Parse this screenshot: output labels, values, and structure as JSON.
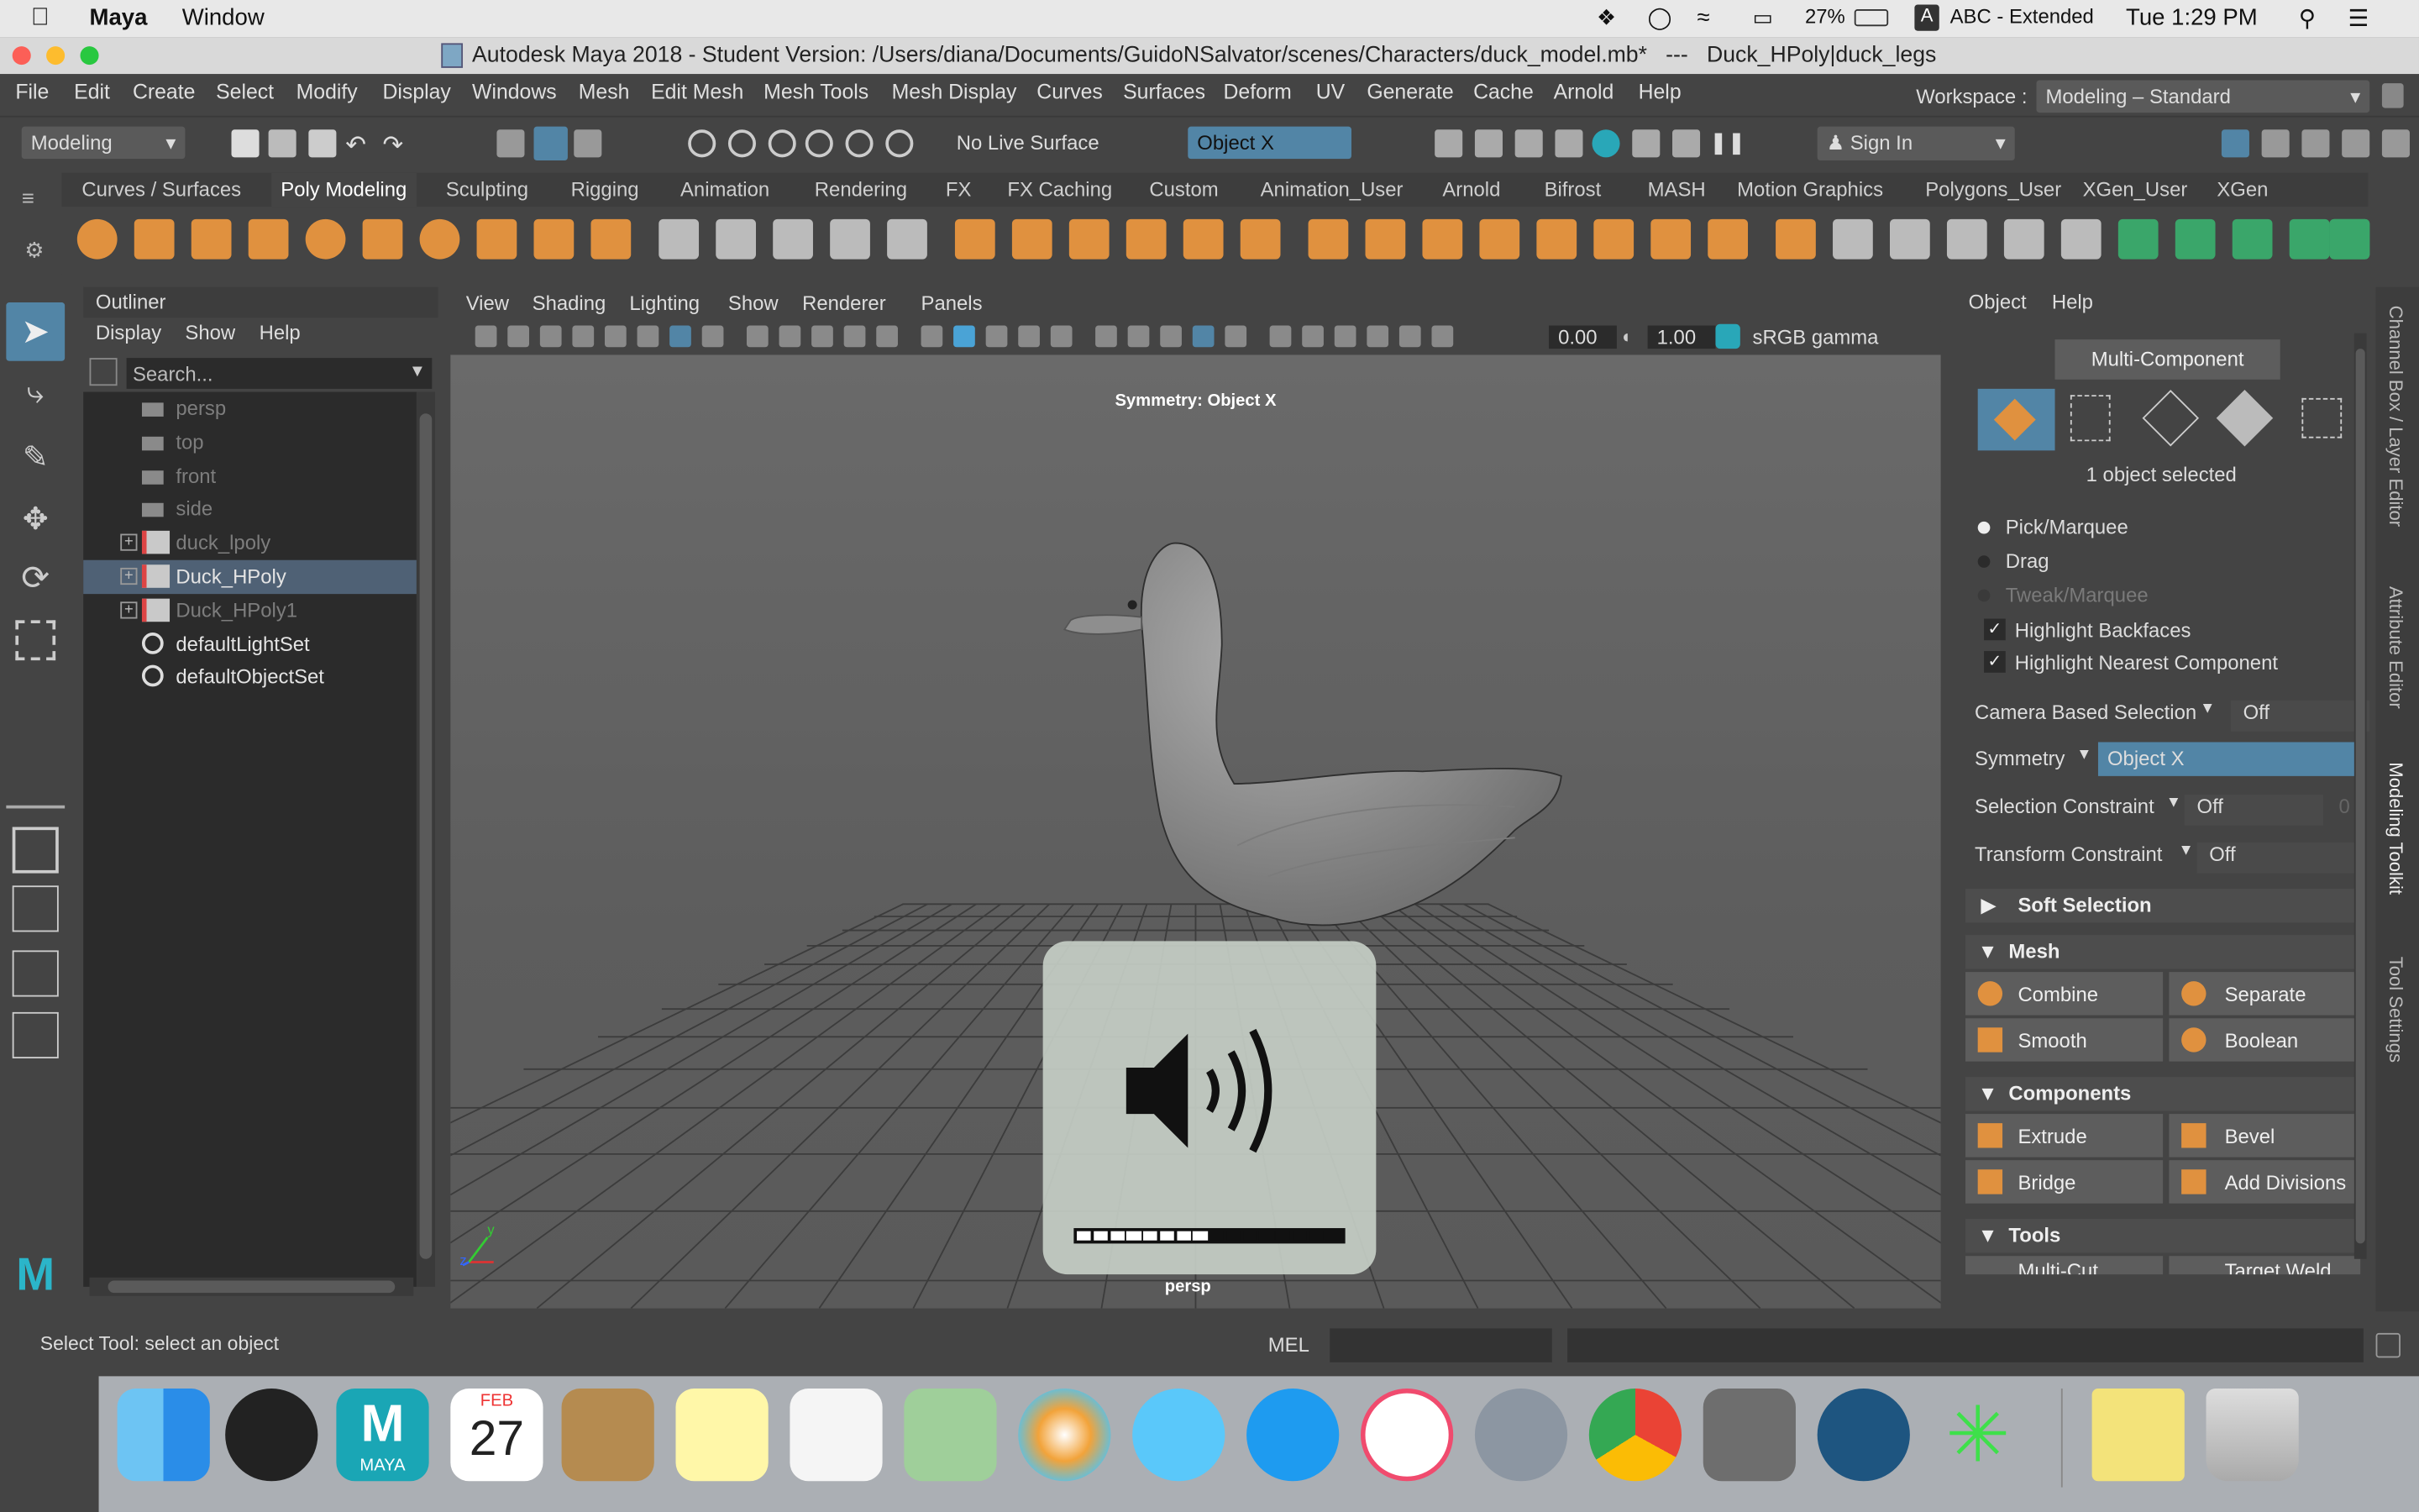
{
  "macbar": {
    "app": "Maya",
    "menu_window": "Window",
    "battery": "27%",
    "input": "ABC - Extended",
    "clock": "Tue 1:29 PM"
  },
  "titlebar": {
    "title": "Autodesk Maya 2018 - Student Version: /Users/diana/Documents/GuidoNSalvator/scenes/Characters/duck_model.mb*   ---   Duck_HPoly|duck_legs"
  },
  "mainmenu": [
    "File",
    "Edit",
    "Create",
    "Select",
    "Modify",
    "Display",
    "Windows",
    "Mesh",
    "Edit Mesh",
    "Mesh Tools",
    "Mesh Display",
    "Curves",
    "Surfaces",
    "Deform",
    "UV",
    "Generate",
    "Cache",
    "Arnold",
    "Help"
  ],
  "workspace": {
    "label": "Workspace :",
    "value": "Modeling – Standard"
  },
  "statusline": {
    "mode": "Modeling",
    "live_surface": "No Live Surface",
    "symmetry": "Object X",
    "sign_in": "Sign In"
  },
  "shelf_tabs": [
    "Curves / Surfaces",
    "Poly Modeling",
    "Sculpting",
    "Rigging",
    "Animation",
    "Rendering",
    "FX",
    "FX Caching",
    "Custom",
    "Animation_User",
    "Arnold",
    "Bifrost",
    "MASH",
    "Motion Graphics",
    "Polygons_User",
    "XGen_User",
    "XGen"
  ],
  "shelf_active": "Poly Modeling",
  "outliner": {
    "title": "Outliner",
    "menu": [
      "Display",
      "Show",
      "Help"
    ],
    "search_placeholder": "Search...",
    "items": [
      {
        "label": "persp",
        "kind": "camera",
        "dim": true
      },
      {
        "label": "top",
        "kind": "camera",
        "dim": true
      },
      {
        "label": "front",
        "kind": "camera",
        "dim": true
      },
      {
        "label": "side",
        "kind": "camera",
        "dim": true
      },
      {
        "label": "duck_lpoly",
        "kind": "mesh",
        "dim": true
      },
      {
        "label": "Duck_HPoly",
        "kind": "mesh",
        "dim": false,
        "selected": true
      },
      {
        "label": "Duck_HPoly1",
        "kind": "mesh",
        "dim": true
      },
      {
        "label": "defaultLightSet",
        "kind": "set",
        "dim": false
      },
      {
        "label": "defaultObjectSet",
        "kind": "set",
        "dim": false
      }
    ]
  },
  "viewport": {
    "menu": [
      "View",
      "Shading",
      "Lighting",
      "Show",
      "Renderer",
      "Panels"
    ],
    "exposure": "0.00",
    "gamma": "1.00",
    "colorspace": "sRGB gamma",
    "symmetry_label": "Symmetry: Object X",
    "camera": "persp",
    "axis_y": "y",
    "axis_z": "z"
  },
  "volume_hud": {
    "level_fraction": 0.5,
    "segments": 16
  },
  "toolkit": {
    "menu": [
      "Object",
      "Help"
    ],
    "mode": "Multi-Component",
    "selected_info": "1 object selected",
    "pick": "Pick/Marquee",
    "drag": "Drag",
    "tweak": "Tweak/Marquee",
    "highlight_backfaces": "Highlight Backfaces",
    "highlight_nearest": "Highlight Nearest Component",
    "camera_sel_label": "Camera Based Selection",
    "camera_sel_value": "Off",
    "symmetry_label": "Symmetry",
    "symmetry_value": "Object X",
    "sel_constraint_label": "Selection Constraint",
    "sel_constraint_value": "Off",
    "sel_constraint_num": "0",
    "xform_constraint_label": "Transform Constraint",
    "xform_constraint_value": "Off",
    "soft_selection": "Soft Selection",
    "mesh_section": "Mesh",
    "combine": "Combine",
    "separate": "Separate",
    "smooth": "Smooth",
    "boolean": "Boolean",
    "components_section": "Components",
    "extrude": "Extrude",
    "bevel": "Bevel",
    "bridge": "Bridge",
    "add_divisions": "Add Divisions",
    "tools_section": "Tools",
    "multi_cut": "Multi-Cut",
    "target_weld": "Target Weld"
  },
  "side_tabs": [
    "Channel Box / Layer Editor",
    "Attribute Editor",
    "Modeling Toolkit",
    "Tool Settings"
  ],
  "helpline": {
    "text": "Select Tool: select an object",
    "mel": "MEL"
  },
  "dock": {
    "calendar_month": "FEB",
    "calendar_day": "27",
    "maya_label": "MAYA"
  },
  "colors": {
    "accent": "#5285a6",
    "orange": "#e0913f",
    "bg": "#444444"
  }
}
